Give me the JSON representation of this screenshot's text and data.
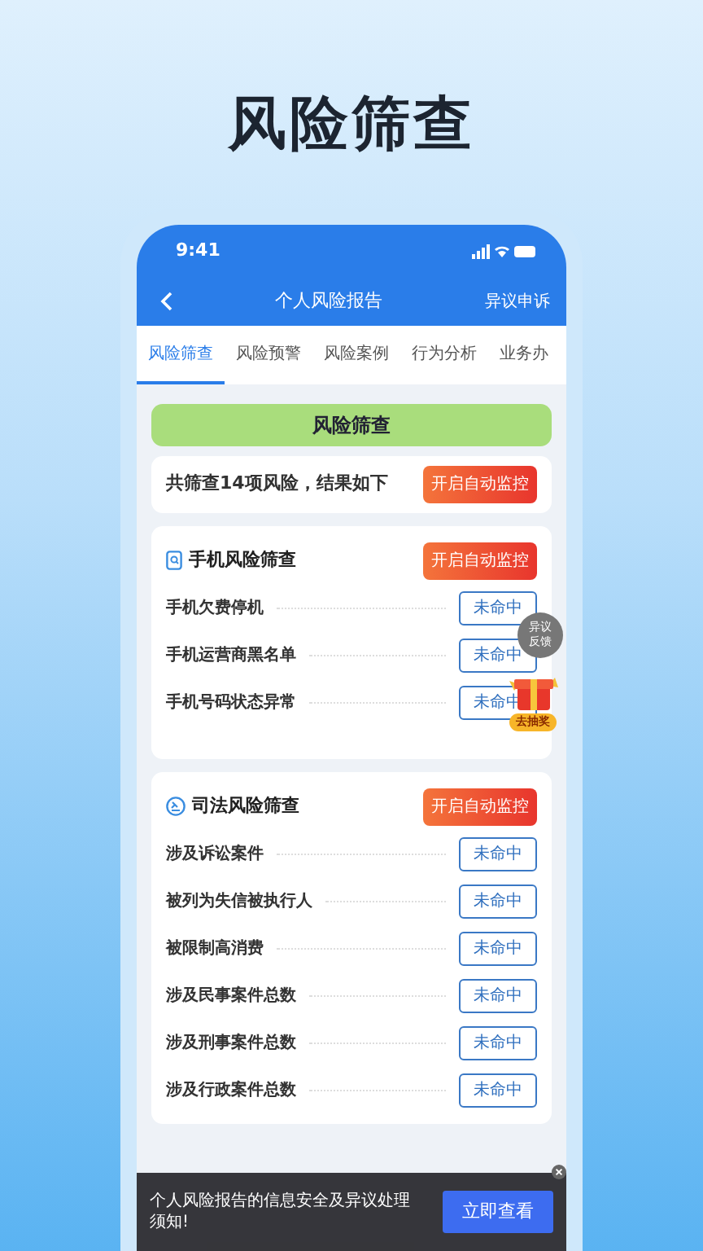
{
  "headline": "风险筛查",
  "status_bar": {
    "time": "9:41"
  },
  "header": {
    "title": "个人风险报告",
    "action": "异议申诉"
  },
  "tabs": [
    {
      "label": "风险筛查",
      "selected": true
    },
    {
      "label": "风险预警",
      "selected": false
    },
    {
      "label": "风险案例",
      "selected": false
    },
    {
      "label": "行为分析",
      "selected": false
    },
    {
      "label": "业务办",
      "selected": false
    }
  ],
  "banner": "风险筛查",
  "summary": {
    "text": "共筛查14项风险，结果如下",
    "button": "开启自动监控"
  },
  "sections": [
    {
      "kind": "phone",
      "title": "手机风险筛查",
      "button": "开启自动监控",
      "items": [
        {
          "label": "手机欠费停机",
          "result": "未命中"
        },
        {
          "label": "手机运营商黑名单",
          "result": "未命中"
        },
        {
          "label": "手机号码状态异常",
          "result": "未命中"
        }
      ]
    },
    {
      "kind": "judicial",
      "title": "司法风险筛查",
      "button": "开启自动监控",
      "items": [
        {
          "label": "涉及诉讼案件",
          "result": "未命中"
        },
        {
          "label": "被列为失信被执行人",
          "result": "未命中"
        },
        {
          "label": "被限制高消费",
          "result": "未命中"
        },
        {
          "label": "涉及民事案件总数",
          "result": "未命中"
        },
        {
          "label": "涉及刑事案件总数",
          "result": "未命中"
        },
        {
          "label": "涉及行政案件总数",
          "result": "未命中"
        }
      ]
    }
  ],
  "feedback": "异议反馈",
  "lottery": "去抽奖",
  "notice": {
    "text": "个人风险报告的信息安全及异议处理须知!",
    "button": "立即查看"
  }
}
